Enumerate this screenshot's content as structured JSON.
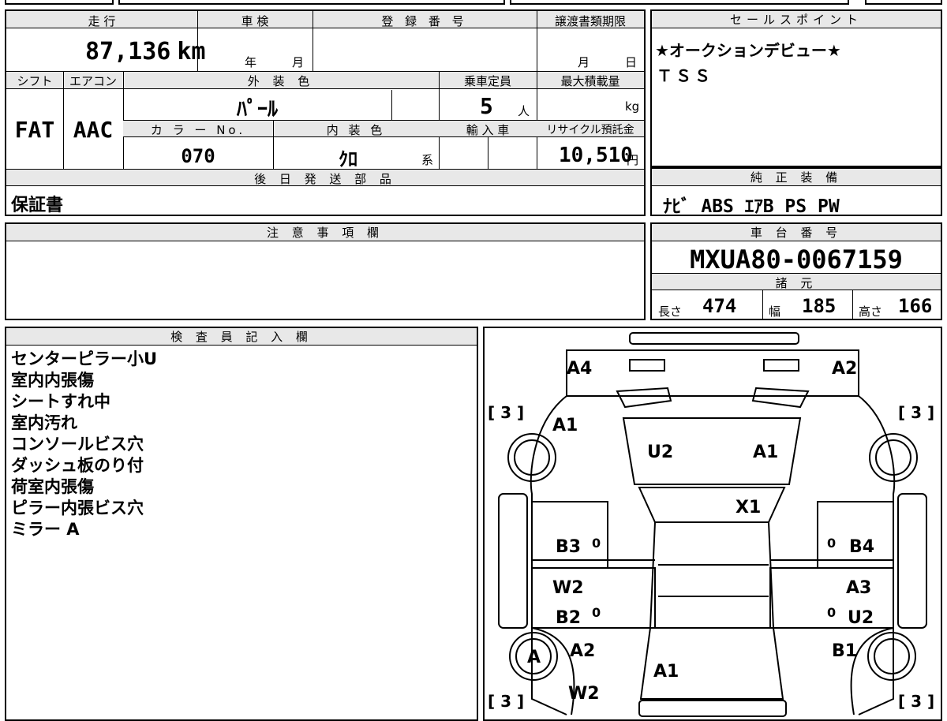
{
  "mileage": {
    "label": "走 行",
    "value": "87,136",
    "unit": "km"
  },
  "inspection": {
    "label": "車 検",
    "year": "年",
    "month": "月"
  },
  "registration": {
    "label": "登 録 番 号",
    "value": ""
  },
  "deadline": {
    "label": "譲渡書類期限",
    "month": "月",
    "day": "日"
  },
  "shift": {
    "label": "シフト",
    "value": "FAT"
  },
  "aircon": {
    "label": "エアコン",
    "value": "AAC"
  },
  "exterior_color": {
    "label": "外 装 色",
    "value": "ﾊﾟｰﾙ"
  },
  "capacity": {
    "label": "乗車定員",
    "value": "5",
    "unit": "人"
  },
  "max_load": {
    "label": "最大積載量",
    "unit": "kg"
  },
  "color_no": {
    "label": "カ ラ ー No.",
    "value": "070"
  },
  "interior_color": {
    "label": "内 装 色",
    "value": "ｸﾛ",
    "suffix": "系"
  },
  "import": {
    "label": "輸 入 車"
  },
  "recycle": {
    "label": "リサイクル預託金",
    "value": "10,510",
    "unit": "円"
  },
  "sales_point": {
    "label": "セールスポイント",
    "lines": [
      "★オークションデビュー★",
      "ＴＳＳ"
    ]
  },
  "later_parts": {
    "label": "後 日 発 送 部 品",
    "value": "保証書"
  },
  "equipment": {
    "label": "純 正 装 備",
    "value": "ﾅﾋﾞ ABS ｴｱB PS PW"
  },
  "notice": {
    "label": "注 意 事 項 欄"
  },
  "chassis": {
    "label": "車 台 番 号",
    "value": "MXUA80-0067159"
  },
  "specs": {
    "label": "諸 元",
    "length_label": "長さ",
    "length": "474",
    "width_label": "幅",
    "width": "185",
    "height_label": "高さ",
    "height": "166"
  },
  "inspector": {
    "label": "検 査 員 記 入 欄",
    "notes": [
      "センターピラー小U",
      "室内内張傷",
      "シートすれ中",
      "室内汚れ",
      "コンソールビス穴",
      "ダッシュ板のり付",
      "荷室内張傷",
      "ピラー内張ビス穴",
      "ミラー A"
    ]
  },
  "diagram": {
    "marks": {
      "rear_left": "A4",
      "rear_right": "A2",
      "rear_panel": "A1",
      "rear_glass_left": "U2",
      "rear_glass_right": "A1",
      "roof": "X1",
      "left_rear_door": "B3",
      "right_rear_door": "B4",
      "left_pillar": "W2",
      "right_pillar": "A3",
      "left_front_door": "B2",
      "right_front_door": "U2",
      "left_fender": "A2",
      "right_fender": "B1",
      "bonnet": "A1",
      "front_left": "W2",
      "left_front_wheel": "A"
    },
    "tire_labels": {
      "tl": "[ 3 ]",
      "tr": "[ 3 ]",
      "bl": "[ 3 ]",
      "br": "[ 3 ]"
    },
    "zeros": [
      "0",
      "0",
      "0",
      "0"
    ]
  }
}
